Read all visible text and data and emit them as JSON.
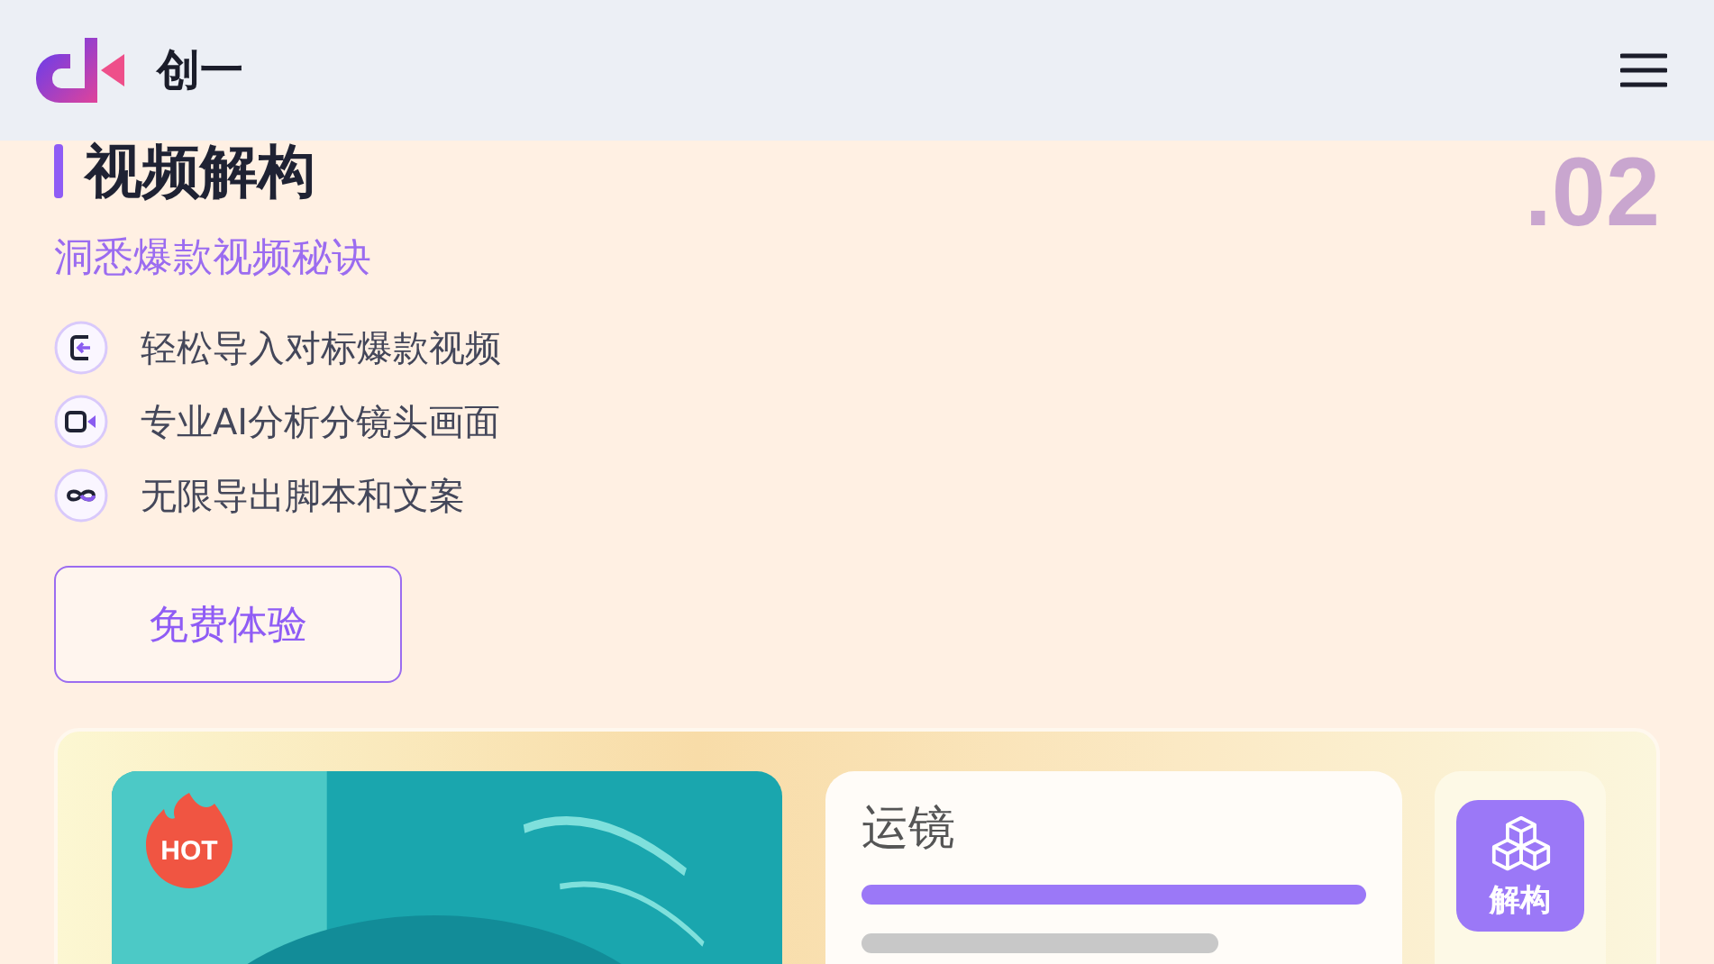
{
  "header": {
    "brand": "创一"
  },
  "section": {
    "index": ".02",
    "title": "视频解构",
    "subtitle": "洞悉爆款视频秘诀",
    "features": [
      {
        "kind": "import",
        "text": "轻松导入对标爆款视频"
      },
      {
        "kind": "camera",
        "text": "专业AI分析分镜头画面"
      },
      {
        "kind": "infinity",
        "text": "无限导出脚本和文案"
      }
    ],
    "cta": "免费体验"
  },
  "preview": {
    "badge": "HOT",
    "panel_title": "运镜",
    "tile_label": "解构"
  }
}
